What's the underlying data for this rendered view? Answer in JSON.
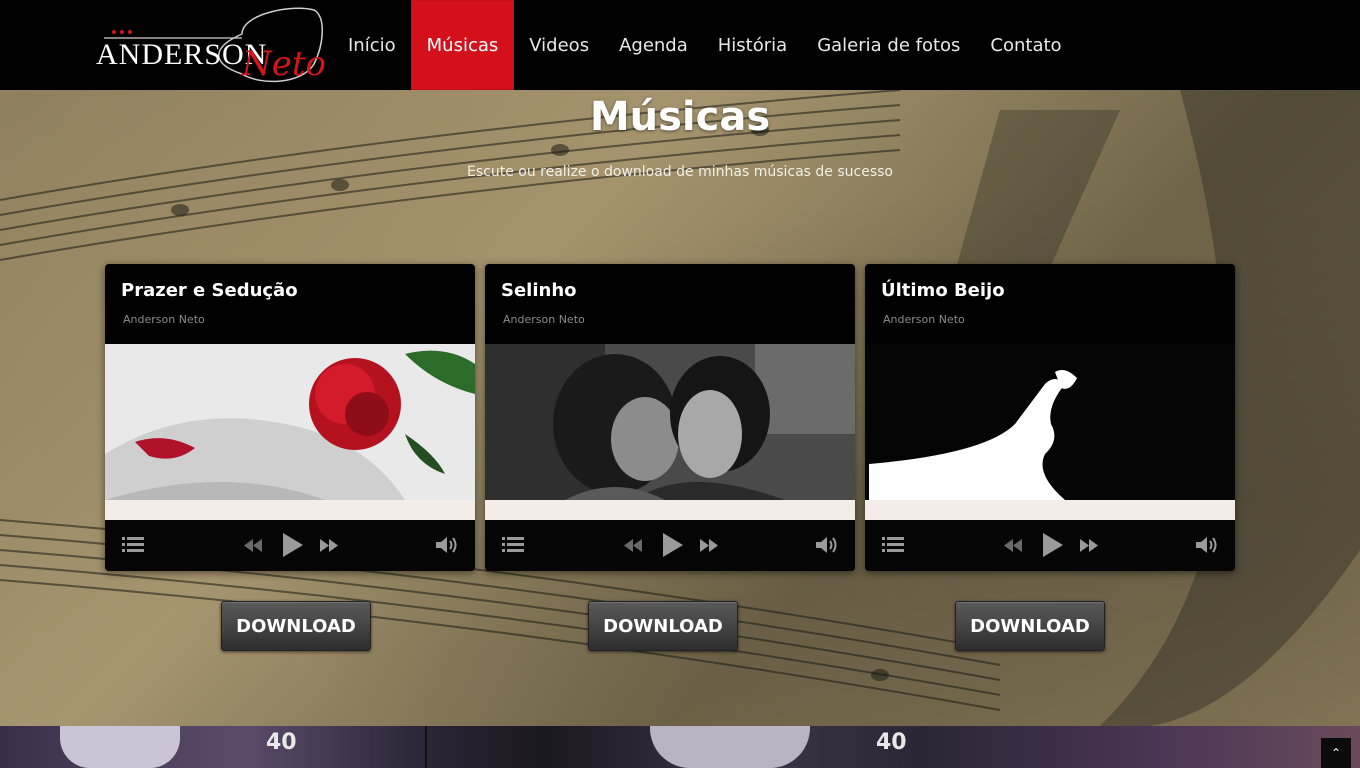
{
  "brand": {
    "logo_main": "ANDERSON",
    "logo_script": "Neto",
    "accent_color": "#d4111a"
  },
  "nav": {
    "items": [
      {
        "label": "Início",
        "active": false
      },
      {
        "label": "Músicas",
        "active": true
      },
      {
        "label": "Videos",
        "active": false
      },
      {
        "label": "Agenda",
        "active": false
      },
      {
        "label": "História",
        "active": false
      },
      {
        "label": "Galeria de fotos",
        "active": false
      },
      {
        "label": "Contato",
        "active": false
      }
    ]
  },
  "page": {
    "title": "Músicas",
    "subtitle": "Escute ou realize o download de minhas músicas de sucesso"
  },
  "tracks": [
    {
      "title": "Prazer e Sedução",
      "artist": "Anderson Neto",
      "cover": "rose-cover-image",
      "download_label": "DOWNLOAD"
    },
    {
      "title": "Selinho",
      "artist": "Anderson Neto",
      "cover": "kiss-cover-image",
      "download_label": "DOWNLOAD"
    },
    {
      "title": "Último Beijo",
      "artist": "Anderson Neto",
      "cover": "silhouette-kiss-cover-image",
      "download_label": "DOWNLOAD"
    }
  ],
  "player_icons": [
    "playlist-icon",
    "previous-icon",
    "play-icon",
    "next-icon",
    "volume-icon"
  ],
  "bottom_strip": {
    "badges": [
      "40",
      "40"
    ]
  },
  "scroll_top": {
    "icon": "chevron-up-icon",
    "glyph": "⌃"
  }
}
